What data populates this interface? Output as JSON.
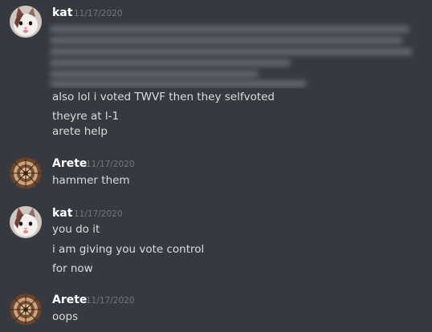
{
  "messages": [
    {
      "author": "kat",
      "timestamp": "11/17/2020",
      "avatar": "cat-avatar-icon",
      "blurred_content": true,
      "lines": [
        "also lol i voted TWVF then they selfvoted",
        "theyre at l-1",
        "arete help"
      ]
    },
    {
      "author": "Arete",
      "timestamp": "11/17/2020",
      "avatar": "mandala-avatar-icon",
      "lines": [
        "hammer them"
      ]
    },
    {
      "author": "kat",
      "timestamp": "11/17/2020",
      "avatar": "cat-avatar-icon",
      "lines": [
        "you do it",
        "i am giving you vote control",
        "for now"
      ]
    },
    {
      "author": "Arete",
      "timestamp": "11/17/2020",
      "avatar": "mandala-avatar-icon",
      "lines": [
        "oops"
      ]
    }
  ],
  "colors": {
    "background": "#36393f",
    "author": "#ffffff",
    "timestamp": "#72767d",
    "text": "#dcddde"
  }
}
